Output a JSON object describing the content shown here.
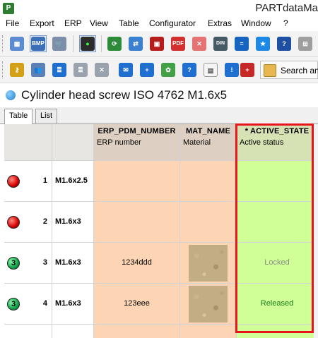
{
  "window": {
    "title": "PARTdataMa"
  },
  "menu": [
    "File",
    "Export",
    "ERP",
    "View",
    "Table",
    "Configurator",
    "Extras",
    "Window",
    "?"
  ],
  "toolbar": {
    "search_label": "Search and"
  },
  "panel": {
    "title": "Cylinder head screw ISO 4762 M1.6x5",
    "tabs": [
      "Table",
      "List"
    ]
  },
  "table": {
    "columns": [
      {
        "name": "ERP_PDM_NUMBER",
        "desc": "ERP number"
      },
      {
        "name": "MAT_NAME",
        "desc": "Material"
      },
      {
        "name": "* ACTIVE_STATE",
        "desc": "Active status"
      }
    ],
    "rows": [
      {
        "lamp": "red",
        "num": "1",
        "name": "M1.6x2.5",
        "erp": "",
        "material": "",
        "state": ""
      },
      {
        "lamp": "red",
        "num": "2",
        "name": "M1.6x3",
        "erp": "",
        "material": "",
        "state": ""
      },
      {
        "lamp": "green",
        "lamp_label": "3",
        "num": "3",
        "name": "M1.6x3",
        "erp": "1234ddd",
        "material": "texture",
        "state": "Locked"
      },
      {
        "lamp": "green",
        "lamp_label": "3",
        "num": "4",
        "name": "M1.6x3",
        "erp": "123eee",
        "material": "texture",
        "state": "Released"
      }
    ]
  },
  "colors": {
    "erp_cell": "#fdd5b4",
    "active_cell": "#cfff96",
    "highlight_border": "#e8141b",
    "locked_text": "#8a8a8a",
    "released_text": "#1a7a1a"
  }
}
